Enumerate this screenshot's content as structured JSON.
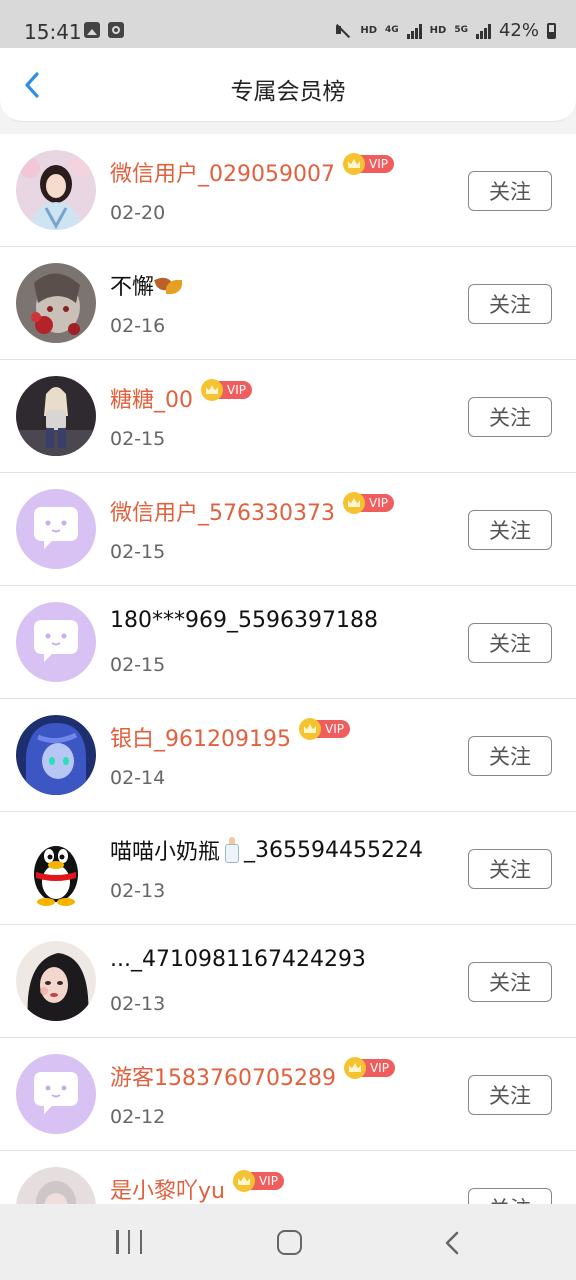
{
  "status_bar": {
    "time": "15:41",
    "hd1": "HD",
    "net1": "4G",
    "hd2": "HD",
    "net2": "5G",
    "battery": "42%"
  },
  "header": {
    "title": "专属会员榜"
  },
  "follow_label": "关注",
  "vip_label": "VIP",
  "members": [
    {
      "name": "微信用户_029059007",
      "date": "02-20",
      "vip": true,
      "avatar": "photo-girl-hanfu-avatar"
    },
    {
      "name": "不懈",
      "date": "02-16",
      "vip": false,
      "avatar": "anime-red-flower-avatar",
      "emoji": "fallen-leaf"
    },
    {
      "name": "糖糖_00",
      "date": "02-15",
      "vip": true,
      "avatar": "photo-girl-dark-avatar"
    },
    {
      "name": "微信用户_576330373",
      "date": "02-15",
      "vip": true,
      "avatar": "default-chat-bubble-avatar"
    },
    {
      "name": "180***969_5596397188",
      "date": "02-15",
      "vip": false,
      "avatar": "default-chat-bubble-avatar"
    },
    {
      "name": "银白_961209195",
      "date": "02-14",
      "vip": true,
      "avatar": "anime-blue-girl-avatar"
    },
    {
      "name_prefix": "喵喵小奶瓶",
      "name": "_365594455224",
      "date": "02-13",
      "vip": false,
      "avatar": "qq-penguin-avatar",
      "emoji": "baby-bottle"
    },
    {
      "name": "..._4710981167424293",
      "date": "02-13",
      "vip": false,
      "avatar": "illustrated-girl-avatar"
    },
    {
      "name": "游客1583760705289",
      "date": "02-12",
      "vip": true,
      "avatar": "default-chat-bubble-avatar"
    },
    {
      "name": "是小黎吖yu",
      "date": "",
      "vip": true,
      "avatar": "photo-partial-avatar"
    }
  ],
  "colors": {
    "vip_name": "#e2603e",
    "vip_badge": "#ef5d5d",
    "crown": "#f5c230",
    "default_avatar_bg": "#d8c2f3",
    "back_arrow": "#2f8ee8"
  }
}
